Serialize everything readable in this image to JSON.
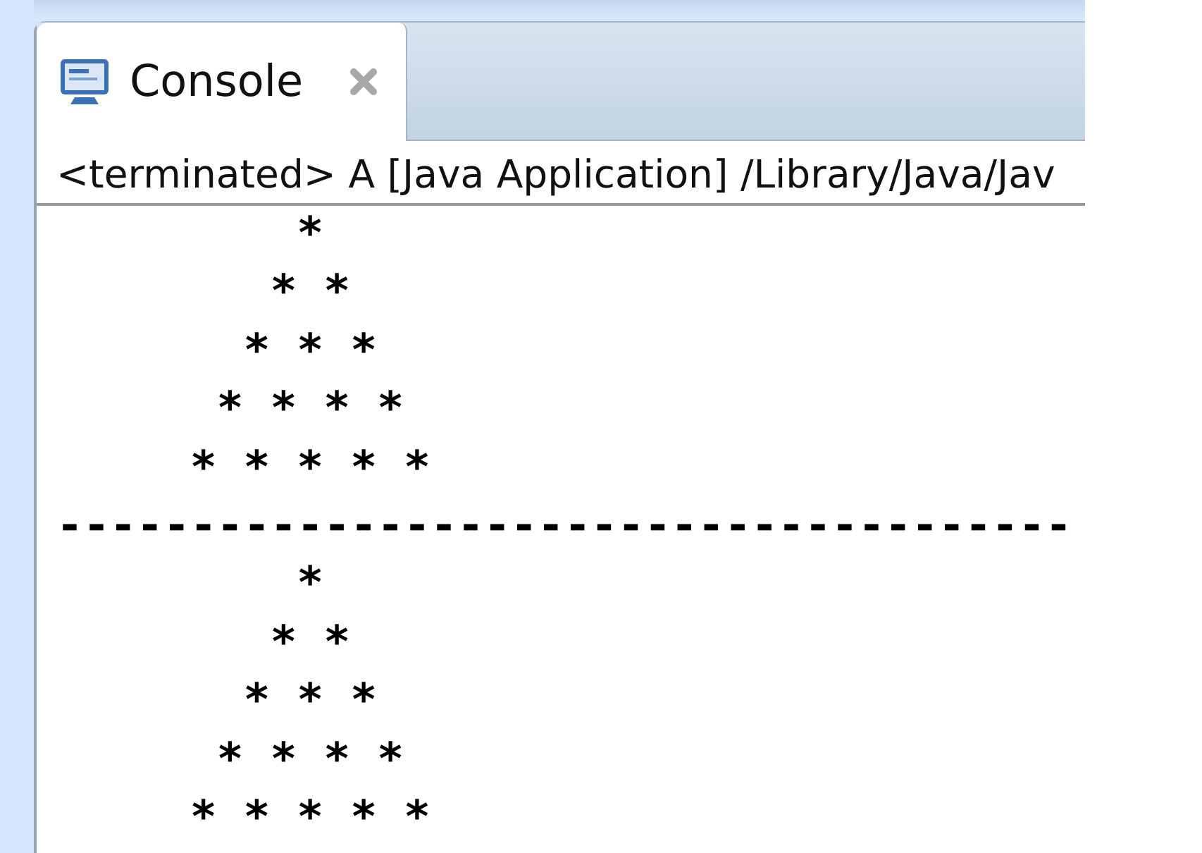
{
  "tabs": [
    {
      "label": "Console",
      "selected": true
    }
  ],
  "console": {
    "header": "<terminated> A [Java Application] /Library/Java/Jav",
    "output": "         *\n        * *\n       * * *\n      * * * *\n     * * * * *\n--------------------------------------\n         *\n        * *\n       * * *\n      * * * *\n     * * * * *"
  }
}
